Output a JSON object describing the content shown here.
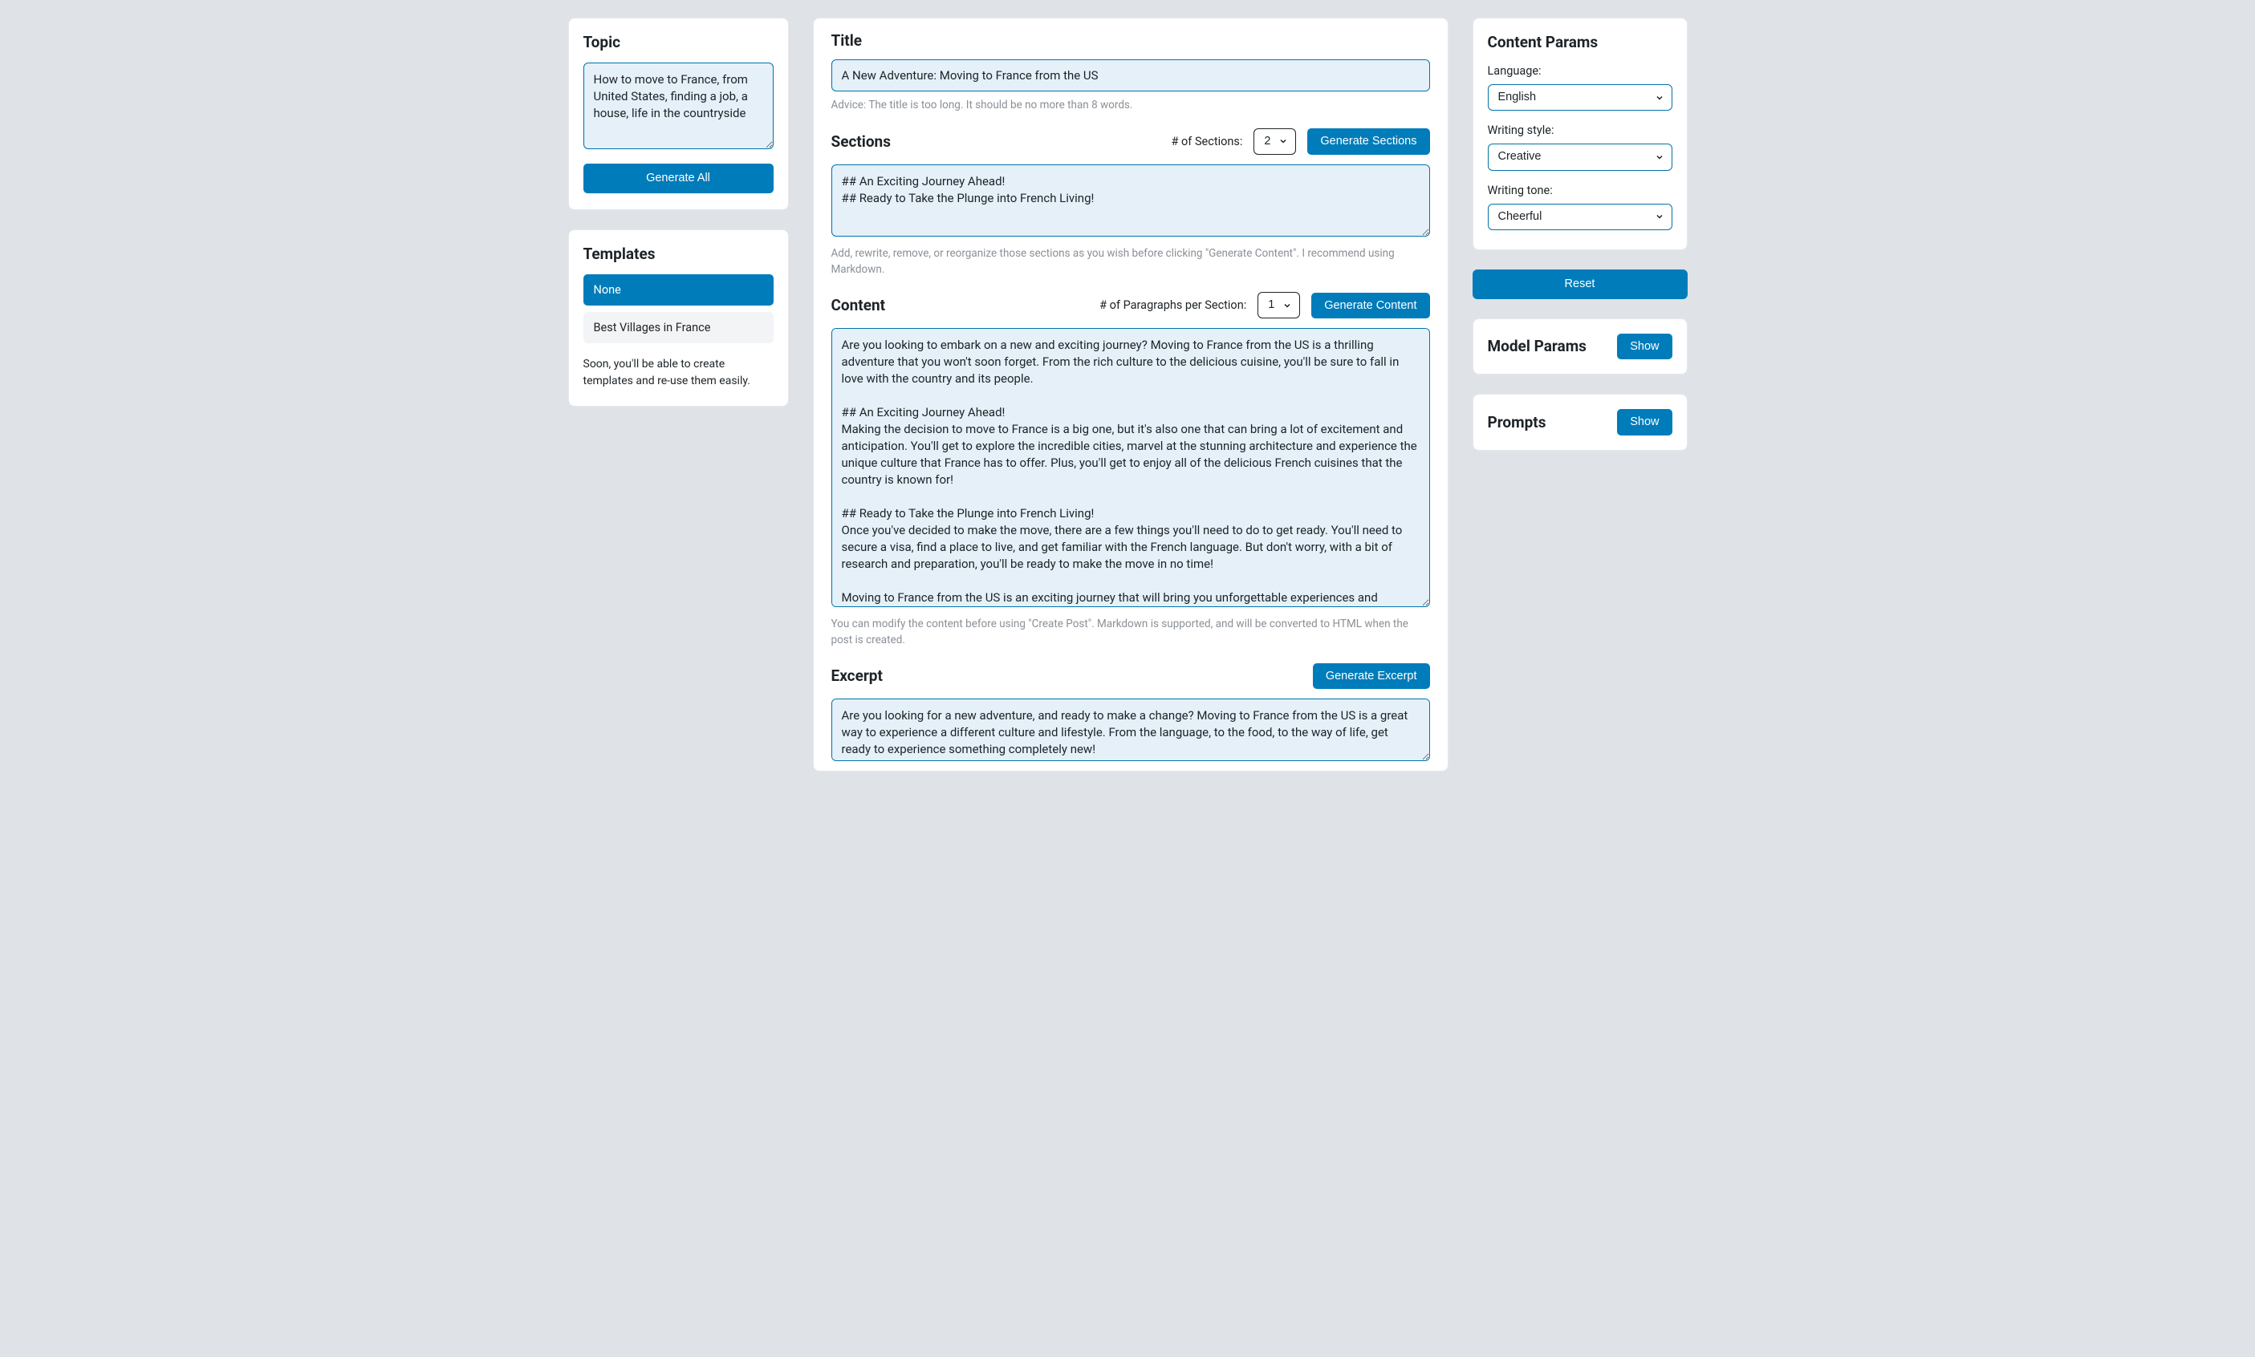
{
  "topic": {
    "heading": "Topic",
    "value": "How to move to France, from United States, finding a job, a house, life in the countryside",
    "generate_all_label": "Generate All"
  },
  "templates": {
    "heading": "Templates",
    "items": [
      {
        "label": "None",
        "active": true
      },
      {
        "label": "Best Villages in France",
        "active": false
      }
    ],
    "note": "Soon, you'll be able to create templates and re-use them easily."
  },
  "title": {
    "heading": "Title",
    "value": "A New Adventure: Moving to France from the US",
    "advice": "Advice: The title is too long. It should be no more than 8 words."
  },
  "sections": {
    "heading": "Sections",
    "count_label": "# of Sections:",
    "count_value": "2",
    "generate_label": "Generate Sections",
    "value": "## An Exciting Journey Ahead!\n## Ready to Take the Plunge into French Living!",
    "note": "Add, rewrite, remove, or reorganize those sections as you wish before clicking \"Generate Content\". I recommend using Markdown."
  },
  "content": {
    "heading": "Content",
    "per_section_label": "# of Paragraphs per Section:",
    "per_section_value": "1",
    "generate_label": "Generate Content",
    "value": "Are you looking to embark on a new and exciting journey? Moving to France from the US is a thrilling adventure that you won't soon forget. From the rich culture to the delicious cuisine, you'll be sure to fall in love with the country and its people.\n\n## An Exciting Journey Ahead!\nMaking the decision to move to France is a big one, but it's also one that can bring a lot of excitement and anticipation. You'll get to explore the incredible cities, marvel at the stunning architecture and experience the unique culture that France has to offer. Plus, you'll get to enjoy all of the delicious French cuisines that the country is known for!\n\n## Ready to Take the Plunge into French Living!\nOnce you've decided to make the move, there are a few things you'll need to do to get ready. You'll need to secure a visa, find a place to live, and get familiar with the French language. But don't worry, with a bit of research and preparation, you'll be ready to make the move in no time!\n\nMoving to France from the US is an exciting journey that will bring you unforgettable experiences and memories. With the right preparation, you'll be ready to take the plunge and start your new life in France!",
    "note": "You can modify the content before using \"Create Post\". Markdown is supported, and will be converted to HTML when the post is created."
  },
  "excerpt": {
    "heading": "Excerpt",
    "generate_label": "Generate Excerpt",
    "value": "Are you looking for a new adventure, and ready to make a change? Moving to France from the US is a great way to experience a different culture and lifestyle. From the language, to the food, to the way of life, get ready to experience something completely new!"
  },
  "content_params": {
    "heading": "Content Params",
    "language_label": "Language:",
    "language_value": "English",
    "style_label": "Writing style:",
    "style_value": "Creative",
    "tone_label": "Writing tone:",
    "tone_value": "Cheerful"
  },
  "reset_label": "Reset",
  "model_params": {
    "heading": "Model Params",
    "show_label": "Show"
  },
  "prompts": {
    "heading": "Prompts",
    "show_label": "Show"
  }
}
